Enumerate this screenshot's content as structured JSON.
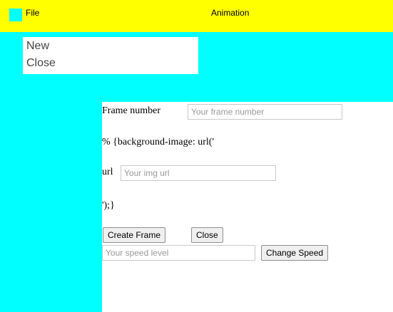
{
  "menubar": {
    "icon": "app-square-icon",
    "file_label": "File",
    "animation_label": "Animation"
  },
  "file_menu": {
    "items": [
      {
        "label": "New"
      },
      {
        "label": "Close"
      }
    ]
  },
  "form": {
    "frame_number_label": "Frame number",
    "frame_number_placeholder": "Your frame number",
    "frame_number_value": "",
    "css_prefix": "% {background-image: url('",
    "url_label": "url",
    "url_placeholder": "Your img url",
    "url_value": "",
    "css_suffix": "');}",
    "create_frame_label": "Create Frame",
    "close_label": "Close",
    "speed_placeholder": "Your speed level",
    "speed_value": "",
    "change_speed_label": "Change Speed"
  },
  "colors": {
    "menubar_bg": "#ffff00",
    "workspace_bg": "#00ffff"
  }
}
